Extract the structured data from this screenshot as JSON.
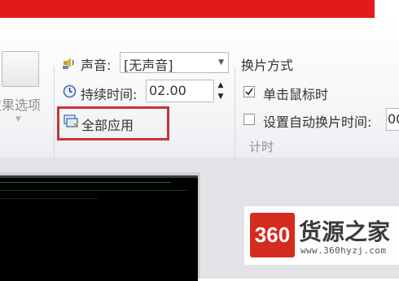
{
  "ribbon": {
    "effect_options_label": "效果选项",
    "sound": {
      "label": "声音:",
      "value": "[无声音]"
    },
    "duration": {
      "label": "持续时间:",
      "value": "02.00"
    },
    "apply_all_label": "全部应用",
    "advance": {
      "title": "换片方式",
      "on_click": {
        "label": "单击鼠标时",
        "checked": true
      },
      "after": {
        "label": "设置自动换片时间:",
        "checked": false,
        "value": "00"
      }
    },
    "group_label": "计时"
  },
  "watermark": {
    "logo_text": "360",
    "title": "货源之家",
    "url": "www.360hyzj.com"
  },
  "colors": {
    "banner": "#e41a1a",
    "highlight_box": "#c8333a",
    "logo": "#d52b1e"
  },
  "icons": [
    "sound-icon",
    "clock-icon",
    "apply-all-icon",
    "checkmark-icon",
    "spin-up-icon",
    "spin-down-icon",
    "dropdown-arrow-icon"
  ]
}
